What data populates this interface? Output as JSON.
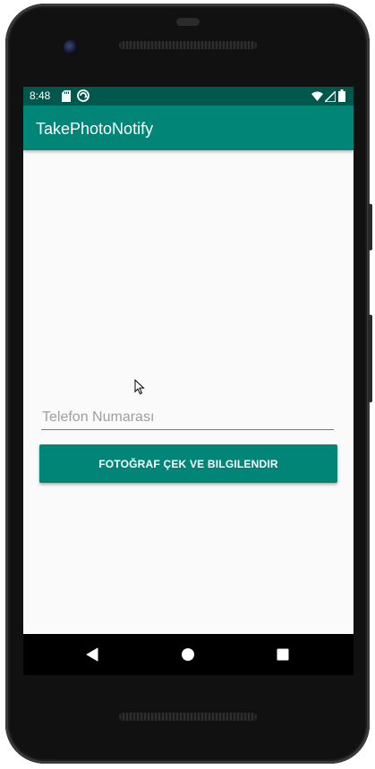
{
  "status_bar": {
    "time": "8:48",
    "icons": [
      "sd-card-icon",
      "sync-icon",
      "wifi-icon",
      "signal-icon",
      "battery-icon"
    ]
  },
  "app_bar": {
    "title": "TakePhotoNotify"
  },
  "form": {
    "phone_placeholder": "Telefon Numarası",
    "phone_value": "",
    "action_button_label": "FOTOĞRAF ÇEK VE BILGILENDIR"
  },
  "nav_bar": {
    "buttons": [
      "back-icon",
      "home-icon",
      "recents-icon"
    ]
  },
  "colors": {
    "primary": "#008577",
    "primary_dark": "#00574b",
    "background": "#fafafa"
  }
}
